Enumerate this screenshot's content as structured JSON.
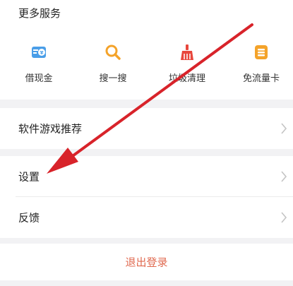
{
  "services": {
    "title": "更多服务",
    "items": [
      {
        "label": "借现金",
        "icon": "cash-loan-icon"
      },
      {
        "label": "搜一搜",
        "icon": "search-icon"
      },
      {
        "label": "垃圾清理",
        "icon": "broom-icon"
      },
      {
        "label": "免流量卡",
        "icon": "data-card-icon"
      }
    ]
  },
  "menu": {
    "software_games": "软件游戏推荐",
    "settings": "设置",
    "feedback": "反馈"
  },
  "logout": {
    "label": "退出登录"
  },
  "colors": {
    "page_bg": "#f2f2f4",
    "card_bg": "#ffffff",
    "icon_blue": "#4a9ee8",
    "icon_orange": "#f4a32a",
    "icon_red": "#e8473c",
    "logout_text": "#e06a50",
    "annotation_arrow": "#d8232a"
  }
}
